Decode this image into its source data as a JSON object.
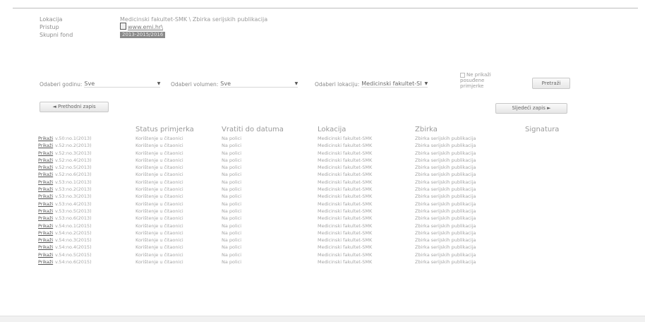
{
  "meta": {
    "lokacija_label": "Lokacija",
    "lokacija_value": "Medicinski fakultet-SMK \\ Zbirka serijskih publikacija",
    "pristup_label": "Pristup",
    "pristup_link": "www.emi.hr\\",
    "fond_label": "Skupni fond",
    "fond_value": "2013-2015/2016"
  },
  "filters": {
    "year_label": "Odaberi godinu:",
    "year_value": "Sve",
    "volume_label": "Odaberi volumen:",
    "volume_value": "Sve",
    "location_label": "Odaberi lokaciju:",
    "location_value": "Medicinski fakultet-SI",
    "checkbox_label": "Ne prikaži posuđene primjerke",
    "submit_label": "Pretraži"
  },
  "nav": {
    "prev_label": "◄ Prethodni zapis",
    "next_label": "Sljedeći zapis ►"
  },
  "table": {
    "headers": [
      "",
      "",
      "Status primjerka",
      "Vratiti do datuma",
      "Lokacija",
      "Zbirka",
      "Signatura"
    ],
    "rows": [
      {
        "action": "Prikaži",
        "volume": "v.50:no.1(2013)",
        "status": "Korištenje u čitaonici",
        "due": "Na polici",
        "location": "Medicinski fakultet-SMK",
        "collection": "Zbirka serijskih publikacija"
      },
      {
        "action": "Prikaži",
        "volume": "v.52:no.2(2013)",
        "status": "Korištenje u čitaonici",
        "due": "Na polici",
        "location": "Medicinski fakultet-SMK",
        "collection": "Zbirka serijskih publikacija"
      },
      {
        "action": "Prikaži",
        "volume": "v.52:no.3(2013)",
        "status": "Korištenje u čitaonici",
        "due": "Na polici",
        "location": "Medicinski fakultet-SMK",
        "collection": "Zbirka serijskih publikacija"
      },
      {
        "action": "Prikaži",
        "volume": "v.52:no.4(2013)",
        "status": "Korištenje u čitaonici",
        "due": "Na polici",
        "location": "Medicinski fakultet-SMK",
        "collection": "Zbirka serijskih publikacija"
      },
      {
        "action": "Prikaži",
        "volume": "v.52:no.5(2013)",
        "status": "Korištenje u čitaonici",
        "due": "Na polici",
        "location": "Medicinski fakultet-SMK",
        "collection": "Zbirka serijskih publikacija"
      },
      {
        "action": "Prikaži",
        "volume": "v.52:no.6(2013)",
        "status": "Korištenje u čitaonici",
        "due": "Na polici",
        "location": "Medicinski fakultet-SMK",
        "collection": "Zbirka serijskih publikacija"
      },
      {
        "action": "Prikaži",
        "volume": "v.53:no.1(2013)",
        "status": "Korištenje u čitaonici",
        "due": "Na polici",
        "location": "Medicinski fakultet-SMK",
        "collection": "Zbirka serijskih publikacija"
      },
      {
        "action": "Prikaži",
        "volume": "v.53:no.2(2013)",
        "status": "Korištenje u čitaonici",
        "due": "Na polici",
        "location": "Medicinski fakultet-SMK",
        "collection": "Zbirka serijskih publikacija"
      },
      {
        "action": "Prikaži",
        "volume": "v.53:no.3(2013)",
        "status": "Korištenje u čitaonici",
        "due": "Na polici",
        "location": "Medicinski fakultet-SMK",
        "collection": "Zbirka serijskih publikacija"
      },
      {
        "action": "Prikaži",
        "volume": "v.53:no.4(2013)",
        "status": "Korištenje u čitaonici",
        "due": "Na polici",
        "location": "Medicinski fakultet-SMK",
        "collection": "Zbirka serijskih publikacija"
      },
      {
        "action": "Prikaži",
        "volume": "v.53:no.5(2013)",
        "status": "Korištenje u čitaonici",
        "due": "Na polici",
        "location": "Medicinski fakultet-SMK",
        "collection": "Zbirka serijskih publikacija"
      },
      {
        "action": "Prikaži",
        "volume": "v.53:no.6(2013)",
        "status": "Korištenje u čitaonici",
        "due": "Na polici",
        "location": "Medicinski fakultet-SMK",
        "collection": "Zbirka serijskih publikacija"
      },
      {
        "action": "Prikaži",
        "volume": "v.54:no.1(2015)",
        "status": "Korištenje u čitaonici",
        "due": "Na polici",
        "location": "Medicinski fakultet-SMK",
        "collection": "Zbirka serijskih publikacija"
      },
      {
        "action": "Prikaži",
        "volume": "v.54:no.2(2015)",
        "status": "Korištenje u čitaonici",
        "due": "Na polici",
        "location": "Medicinski fakultet-SMK",
        "collection": "Zbirka serijskih publikacija"
      },
      {
        "action": "Prikaži",
        "volume": "v.54:no.3(2015)",
        "status": "Korištenje u čitaonici",
        "due": "Na polici",
        "location": "Medicinski fakultet-SMK",
        "collection": "Zbirka serijskih publikacija"
      },
      {
        "action": "Prikaži",
        "volume": "v.54:no.4(2015)",
        "status": "Korištenje u čitaonici",
        "due": "Na polici",
        "location": "Medicinski fakultet-SMK",
        "collection": "Zbirka serijskih publikacija"
      },
      {
        "action": "Prikaži",
        "volume": "v.54:no.5(2015)",
        "status": "Korištenje u čitaonici",
        "due": "Na polici",
        "location": "Medicinski fakultet-SMK",
        "collection": "Zbirka serijskih publikacija"
      },
      {
        "action": "Prikaži",
        "volume": "v.54:no.6(2015)",
        "status": "Korištenje u čitaonici",
        "due": "Na polici",
        "location": "Medicinski fakultet-SMK",
        "collection": "Zbirka serijskih publikacija"
      }
    ]
  },
  "icons": {
    "pristup": "document-icon",
    "dropdown": "chevron-down-icon"
  }
}
